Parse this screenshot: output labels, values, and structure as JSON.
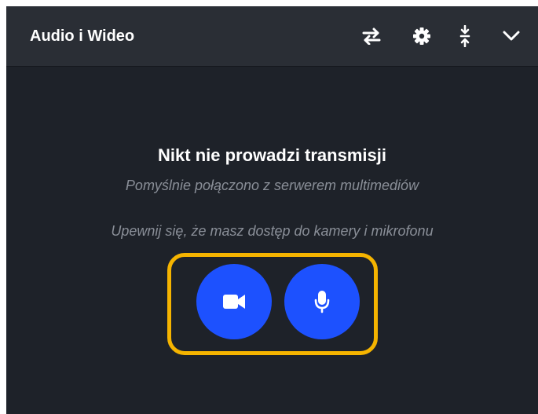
{
  "panel": {
    "title": "Audio i Wideo",
    "header_icons": [
      "swap-icon",
      "gear-icon",
      "collapse-vertical-icon",
      "chevron-down-icon"
    ]
  },
  "empty_state": {
    "title": "Nikt nie prowadzi transmisji",
    "status": "Pomyślnie połączono z serwerem multimediów",
    "hint": "Upewnij się, że masz dostęp do kamery i mikrofonu"
  },
  "media_buttons": {
    "camera_icon": "video-camera-icon",
    "microphone_icon": "microphone-icon"
  },
  "colors": {
    "panel_background": "#1e2229",
    "header_background": "#2a2e35",
    "accent_button": "#1d51fe",
    "highlight": "#f5b400",
    "muted_text": "#8a8f98"
  }
}
